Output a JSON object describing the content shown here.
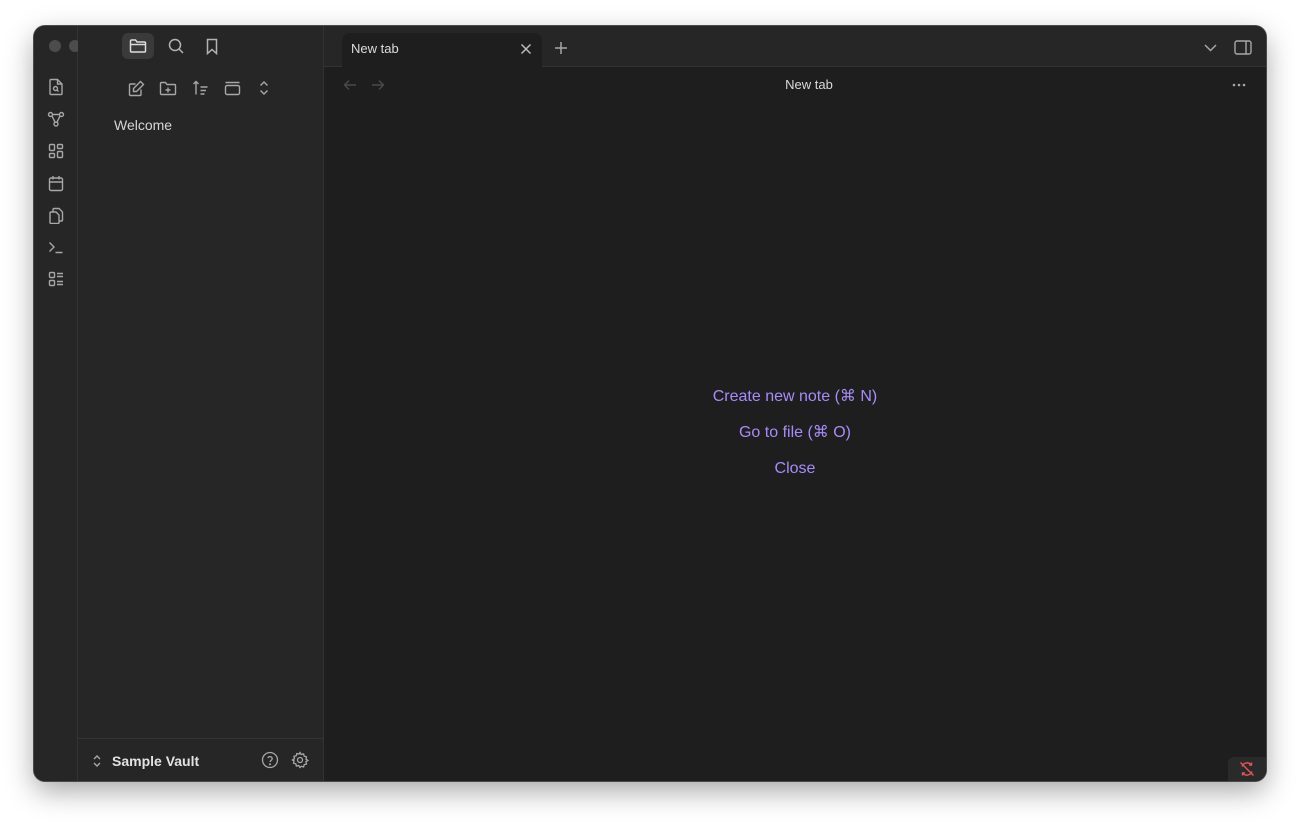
{
  "window": {
    "title": "Sample Vault"
  },
  "ribbon": {
    "icons": [
      "quick-switcher-icon",
      "graph-view-icon",
      "canvas-icon",
      "daily-note-icon",
      "templates-icon",
      "command-palette-icon",
      "outline-icon"
    ]
  },
  "sidebar": {
    "tabs": [
      "files-icon",
      "search-icon",
      "bookmarks-icon"
    ],
    "file_actions": [
      "new-note-icon",
      "new-folder-icon",
      "sort-icon",
      "collapse-icon",
      "expand-collapse-icon"
    ],
    "files": [
      "Welcome"
    ],
    "vault_name": "Sample Vault"
  },
  "tabs": [
    {
      "label": "New tab"
    }
  ],
  "view": {
    "title": "New tab"
  },
  "empty_state": {
    "create_note": "Create new note (⌘ N)",
    "go_to_file": "Go to file (⌘ O)",
    "close": "Close"
  },
  "colors": {
    "accent": "#a88bfa",
    "background": "#1e1e1e",
    "sidebar": "#262626",
    "sync_error": "#e05555"
  }
}
